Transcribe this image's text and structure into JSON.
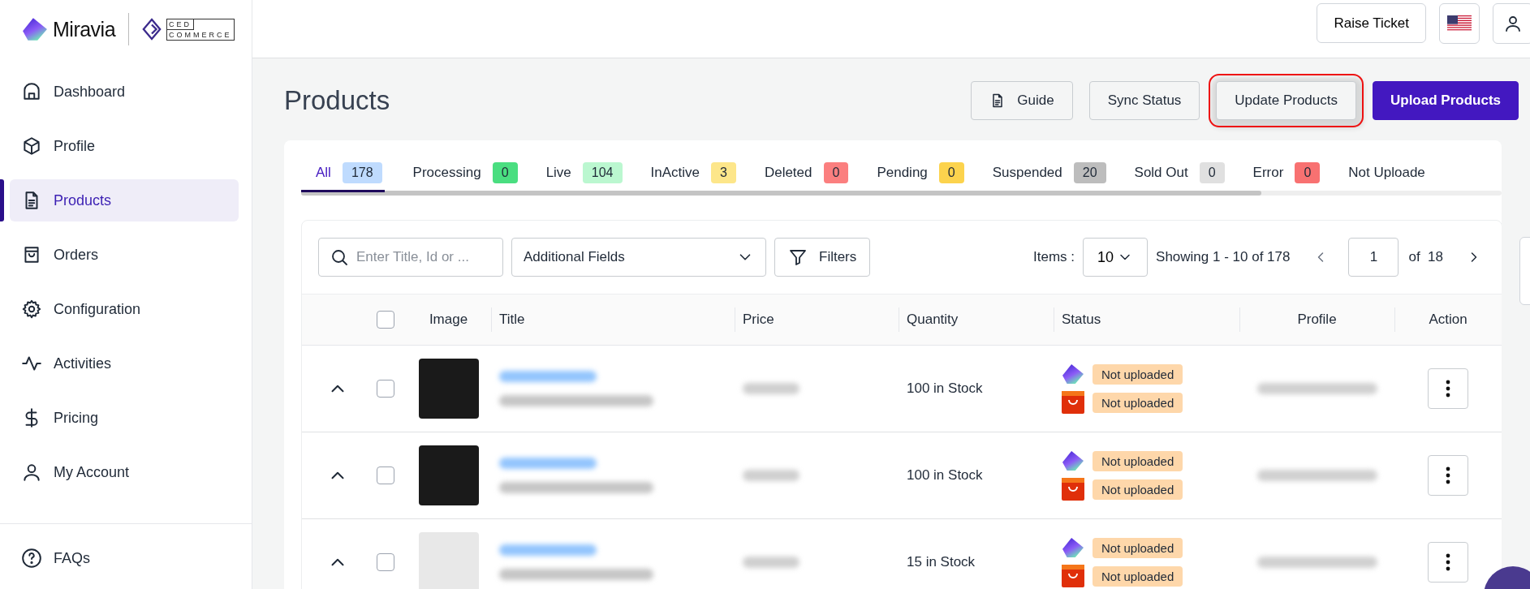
{
  "logo": {
    "brand": "Miravia",
    "partner_top": "CED",
    "partner_bottom": "COMMERCE"
  },
  "header": {
    "ticket_button": "Raise Ticket"
  },
  "sidebar": {
    "items": [
      {
        "label": "Dashboard",
        "kind": "home",
        "selected": false
      },
      {
        "label": "Profile",
        "kind": "box",
        "selected": false
      },
      {
        "label": "Products",
        "kind": "document",
        "selected": true
      },
      {
        "label": "Orders",
        "kind": "bag",
        "selected": false
      },
      {
        "label": "Configuration",
        "kind": "gear",
        "selected": false
      },
      {
        "label": "Activities",
        "kind": "activity",
        "selected": false
      },
      {
        "label": "Pricing",
        "kind": "dollar",
        "selected": false
      },
      {
        "label": "My Account",
        "kind": "user",
        "selected": false
      }
    ],
    "footer_items": [
      {
        "label": "FAQs",
        "kind": "help"
      }
    ]
  },
  "page": {
    "title": "Products",
    "actions": [
      {
        "label": "Guide",
        "kind": "guide",
        "highlighted": false
      },
      {
        "label": "Sync Status",
        "kind": "plain",
        "highlighted": false
      },
      {
        "label": "Update Products",
        "kind": "plain",
        "highlighted": true
      },
      {
        "label": "Upload Products",
        "kind": "primary",
        "highlighted": false
      }
    ]
  },
  "tabs": [
    {
      "label": "All",
      "count": "178",
      "color": "#bfdbfe",
      "selected": true
    },
    {
      "label": "Processing",
      "count": "0",
      "color": "#4ade80",
      "selected": false
    },
    {
      "label": "Live",
      "count": "104",
      "color": "#bbf7d0",
      "selected": false
    },
    {
      "label": "InActive",
      "count": "3",
      "color": "#fde68a",
      "selected": false
    },
    {
      "label": "Deleted",
      "count": "0",
      "color": "#fb7f7f",
      "selected": false
    },
    {
      "label": "Pending",
      "count": "0",
      "color": "#fcd34d",
      "selected": false
    },
    {
      "label": "Suspended",
      "count": "20",
      "color": "#bdbdbd",
      "selected": false
    },
    {
      "label": "Sold Out",
      "count": "0",
      "color": "#e0e0e0",
      "selected": false
    },
    {
      "label": "Error",
      "count": "0",
      "color": "#f87171",
      "selected": false
    },
    {
      "label": "Not Uploade",
      "selected": false
    }
  ],
  "toolbar": {
    "search_placeholder": "Enter Title, Id or ...",
    "fields_dropdown": "Additional Fields",
    "filter_button": "Filters",
    "items_label": "Items :",
    "page_size": "10",
    "showing": "Showing 1 - 10 of 178",
    "page": "1",
    "page_of": "of  18"
  },
  "table": {
    "header_checked": false,
    "columns": [
      "Image",
      "Title",
      "Price",
      "Quantity",
      "Status",
      "Profile",
      "Action"
    ],
    "rows": [
      {
        "expanded": true,
        "checked": false,
        "photo_dark": true,
        "quantity": "100 in Stock",
        "statuses": [
          {
            "kind": "miravia",
            "label": "Not uploaded"
          },
          {
            "kind": "bag",
            "label": "Not uploaded"
          }
        ]
      },
      {
        "expanded": true,
        "checked": false,
        "photo_dark": true,
        "quantity": "100 in Stock",
        "statuses": [
          {
            "kind": "miravia",
            "label": "Not uploaded"
          },
          {
            "kind": "bag",
            "label": "Not uploaded"
          }
        ]
      },
      {
        "expanded": true,
        "checked": false,
        "photo_dark": false,
        "quantity": "15 in Stock",
        "statuses": [
          {
            "kind": "miravia",
            "label": "Not uploaded"
          },
          {
            "kind": "bag",
            "label": "Not uploaded"
          }
        ]
      }
    ]
  }
}
